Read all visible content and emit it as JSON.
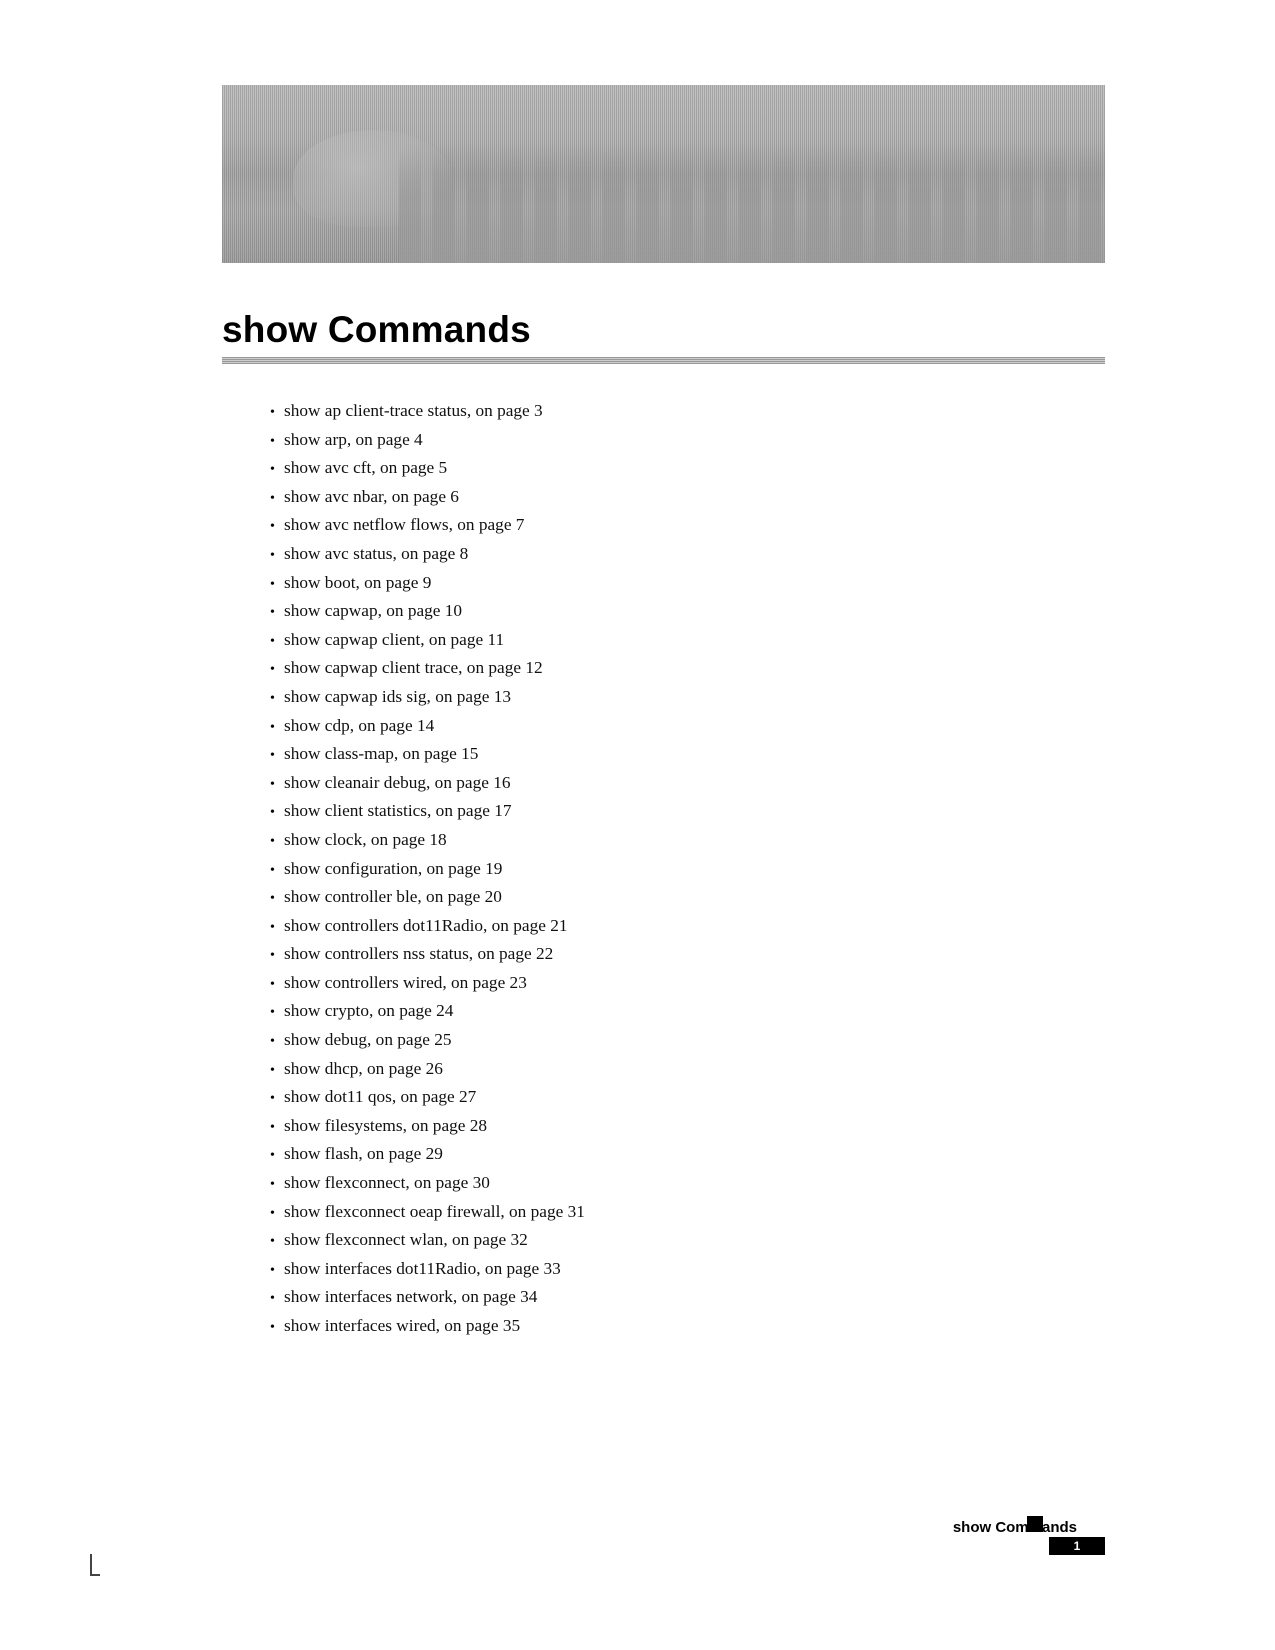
{
  "header": {
    "title": "show Commands"
  },
  "toc": {
    "prefix": "show ",
    "items": [
      {
        "cmd": "ap client-trace status",
        "page": 3
      },
      {
        "cmd": "arp",
        "page": 4
      },
      {
        "cmd": "avc cft",
        "page": 5
      },
      {
        "cmd": "avc nbar",
        "page": 6
      },
      {
        "cmd": "avc netflow flows",
        "page": 7
      },
      {
        "cmd": "avc status",
        "page": 8
      },
      {
        "cmd": "boot",
        "page": 9
      },
      {
        "cmd": "capwap",
        "page": 10
      },
      {
        "cmd": "capwap client",
        "page": 11
      },
      {
        "cmd": "capwap client trace",
        "page": 12
      },
      {
        "cmd": "capwap ids sig",
        "page": 13
      },
      {
        "cmd": "cdp",
        "page": 14
      },
      {
        "cmd": "class-map",
        "page": 15
      },
      {
        "cmd": "cleanair debug",
        "page": 16
      },
      {
        "cmd": "client statistics",
        "page": 17
      },
      {
        "cmd": "clock",
        "page": 18
      },
      {
        "cmd": "configuration",
        "page": 19
      },
      {
        "cmd": "controller ble",
        "page": 20
      },
      {
        "cmd": "controllers dot11Radio",
        "page": 21
      },
      {
        "cmd": "controllers nss status",
        "page": 22
      },
      {
        "cmd": "controllers wired",
        "page": 23
      },
      {
        "cmd": "crypto",
        "page": 24
      },
      {
        "cmd": "debug",
        "page": 25
      },
      {
        "cmd": "dhcp",
        "page": 26
      },
      {
        "cmd": "dot11 qos",
        "page": 27
      },
      {
        "cmd": "filesystems",
        "page": 28
      },
      {
        "cmd": "flash",
        "page": 29
      },
      {
        "cmd": "flexconnect",
        "page": 30
      },
      {
        "cmd": "flexconnect oeap firewall",
        "page": 31
      },
      {
        "cmd": "flexconnect wlan",
        "page": 32
      },
      {
        "cmd": "interfaces dot11Radio",
        "page": 33
      },
      {
        "cmd": "interfaces network",
        "page": 34
      },
      {
        "cmd": "interfaces wired",
        "page": 35
      }
    ],
    "sep": ", on page "
  },
  "footer": {
    "label": "show Commands",
    "page_number": "1"
  }
}
